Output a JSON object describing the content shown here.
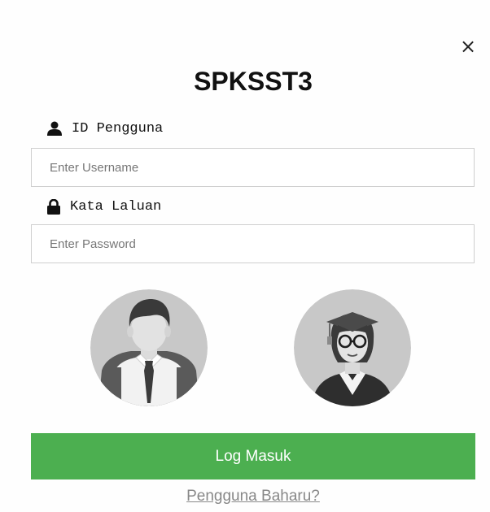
{
  "modal": {
    "close_symbol": "×",
    "title": "SPKSST3"
  },
  "form": {
    "username_label": "ID Pengguna",
    "username_placeholder": "Enter Username",
    "username_icon": "user-icon",
    "password_label": "Kata Laluan",
    "password_placeholder": "Enter Password",
    "password_icon": "lock-icon"
  },
  "avatars": [
    {
      "name": "student-avatar"
    },
    {
      "name": "graduate-avatar"
    }
  ],
  "actions": {
    "login_label": "Log Masuk",
    "register_label": "Pengguna Baharu?"
  },
  "colors": {
    "login_button": "#4caf50",
    "register_link": "#888888"
  }
}
